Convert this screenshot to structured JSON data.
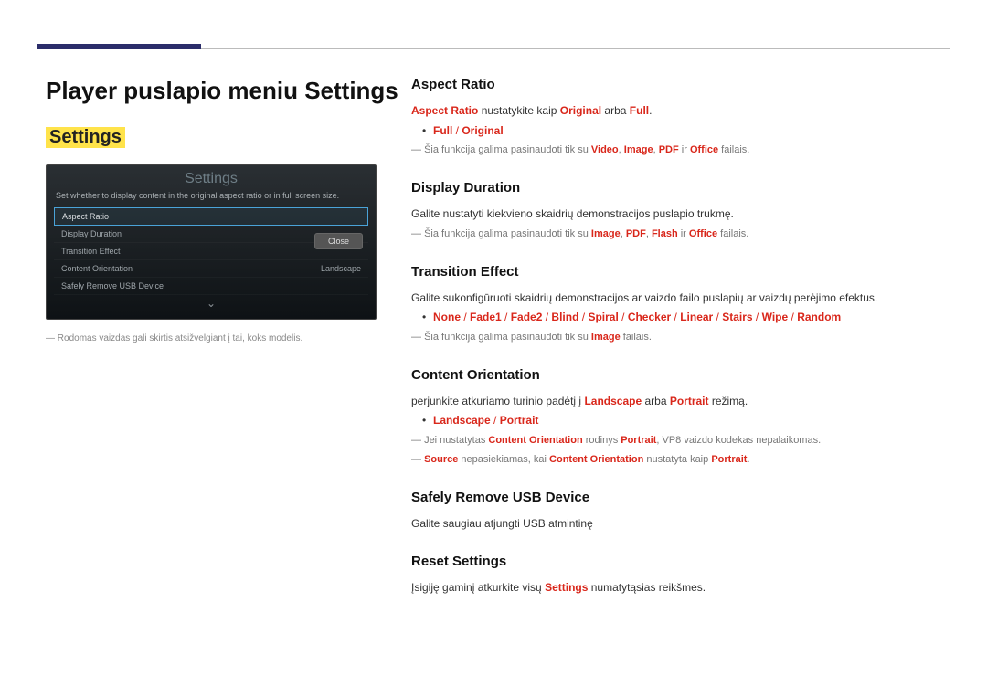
{
  "header": {
    "page_title": "Player puslapio meniu Settings",
    "section_title": "Settings"
  },
  "device": {
    "title": "Settings",
    "description": "Set whether to display content in the original aspect ratio or in full screen size.",
    "rows": {
      "r0": "Aspect Ratio",
      "r1": "Display Duration",
      "r2": "Transition Effect",
      "r3": "Content Orientation",
      "r3v": "Landscape",
      "r4": "Safely Remove USB Device"
    },
    "close": "Close",
    "chevron": "⌄"
  },
  "left_footnote": "Rodomas vaizdas gali skirtis atsižvelgiant į tai, koks modelis.",
  "right": {
    "aspect": {
      "title": "Aspect Ratio",
      "l1a": "Aspect Ratio",
      "l1b": " nustatykite kaip ",
      "l1c": "Original",
      "l1d": " arba ",
      "l1e": "Full",
      "l1f": ".",
      "b1a": "Full",
      "b1s": " / ",
      "b1b": "Original",
      "n1a": "Šia funkcija galima pasinaudoti tik su ",
      "n1b": "Video",
      "n1c": ", ",
      "n1d": "Image",
      "n1e": ", ",
      "n1f": "PDF",
      "n1g": " ir ",
      "n1h": "Office",
      "n1i": " failais."
    },
    "duration": {
      "title": "Display Duration",
      "l1": "Galite nustatyti kiekvieno skaidrių demonstracijos puslapio trukmę.",
      "n1a": "Šia funkcija galima pasinaudoti tik su ",
      "n1b": "Image",
      "n1c": ", ",
      "n1d": "PDF",
      "n1e": ", ",
      "n1f": "Flash",
      "n1g": " ir ",
      "n1h": "Office",
      "n1i": " failais."
    },
    "transition": {
      "title": "Transition Effect",
      "l1": "Galite sukonfigūruoti skaidrių demonstracijos ar vaizdo failo puslapių ar vaizdų perėjimo efektus.",
      "b_none": "None",
      "b_f1": "Fade1",
      "b_f2": "Fade2",
      "b_blind": "Blind",
      "b_spiral": "Spiral",
      "b_checker": "Checker",
      "b_linear": "Linear",
      "b_stairs": "Stairs",
      "b_wipe": "Wipe",
      "b_random": "Random",
      "sep": " / ",
      "n1a": "Šia funkcija galima pasinaudoti tik su ",
      "n1b": "Image",
      "n1c": " failais."
    },
    "orientation": {
      "title": "Content Orientation",
      "l1a": "perjunkite atkuriamo turinio padėtį į ",
      "l1b": "Landscape",
      "l1c": " arba ",
      "l1d": "Portrait",
      "l1e": " režimą.",
      "b1a": "Landscape",
      "b1s": " / ",
      "b1b": "Portrait",
      "n1a": "Jei nustatytas ",
      "n1b": "Content Orientation",
      "n1c": " rodinys ",
      "n1d": "Portrait",
      "n1e": ", VP8 vaizdo kodekas nepalaikomas.",
      "n2a": "Source",
      "n2b": " nepasiekiamas, kai ",
      "n2c": "Content Orientation",
      "n2d": " nustatyta kaip ",
      "n2e": "Portrait",
      "n2f": "."
    },
    "usb": {
      "title": "Safely Remove USB Device",
      "l1": "Galite saugiau atjungti USB atmintinę"
    },
    "reset": {
      "title": "Reset Settings",
      "l1a": "Įsigiję gaminį atkurkite visų ",
      "l1b": "Settings",
      "l1c": " numatytąsias reikšmes."
    }
  }
}
